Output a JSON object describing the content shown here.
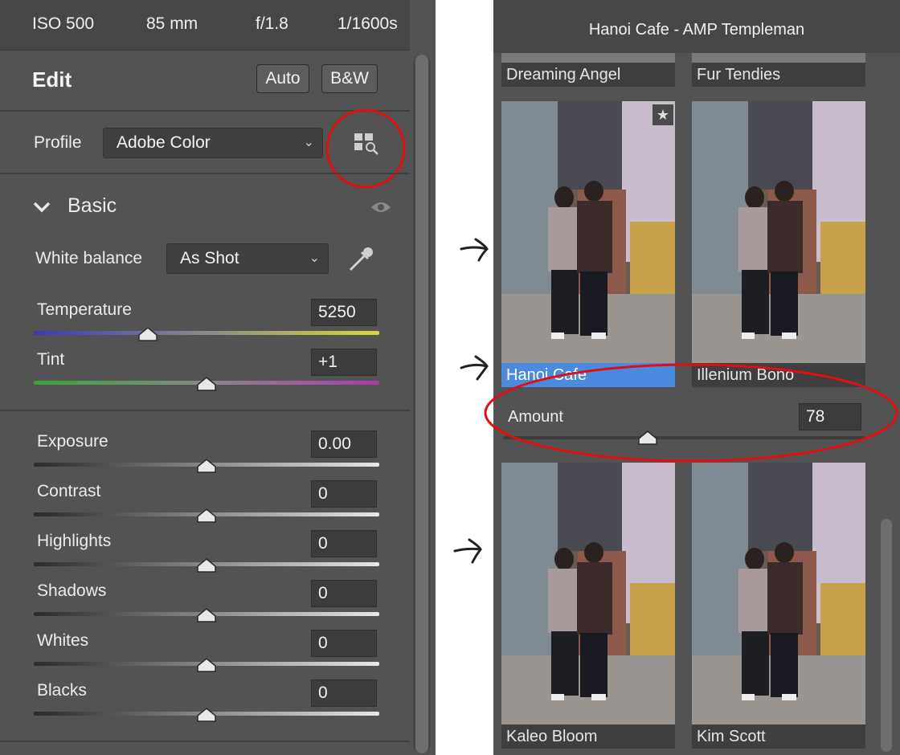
{
  "info_bar": {
    "iso": "ISO 500",
    "focal": "85 mm",
    "aperture": "f/1.8",
    "shutter": "1/1600s"
  },
  "edit": {
    "title": "Edit",
    "auto_label": "Auto",
    "bw_label": "B&W"
  },
  "profile": {
    "label": "Profile",
    "value": "Adobe Color"
  },
  "basic": {
    "title": "Basic"
  },
  "white_balance": {
    "label": "White balance",
    "value": "As Shot"
  },
  "sliders": [
    {
      "label": "Temperature",
      "value": "5250",
      "position": 0.33
    },
    {
      "label": "Tint",
      "value": "+1",
      "position": 0.5
    },
    {
      "label": "Exposure",
      "value": "0.00",
      "position": 0.5
    },
    {
      "label": "Contrast",
      "value": "0",
      "position": 0.5
    },
    {
      "label": "Highlights",
      "value": "0",
      "position": 0.5
    },
    {
      "label": "Shadows",
      "value": "0",
      "position": 0.5
    },
    {
      "label": "Whites",
      "value": "0",
      "position": 0.5
    },
    {
      "label": "Blacks",
      "value": "0",
      "position": 0.5
    }
  ],
  "browser": {
    "title": "Hanoi Cafe - AMP Templeman",
    "top_labels": [
      "Dreaming Angel",
      "Fur Tendies"
    ],
    "row1": [
      "Hanoi Cafe",
      "Illenium Bono"
    ],
    "row2": [
      "Kaleo Bloom",
      "Kim Scott"
    ],
    "amount": {
      "label": "Amount",
      "value": "78",
      "position": 0.4
    }
  },
  "colors": {
    "panel": "#535353",
    "selected": "#4a8bdf",
    "annotation": "#e01010"
  }
}
